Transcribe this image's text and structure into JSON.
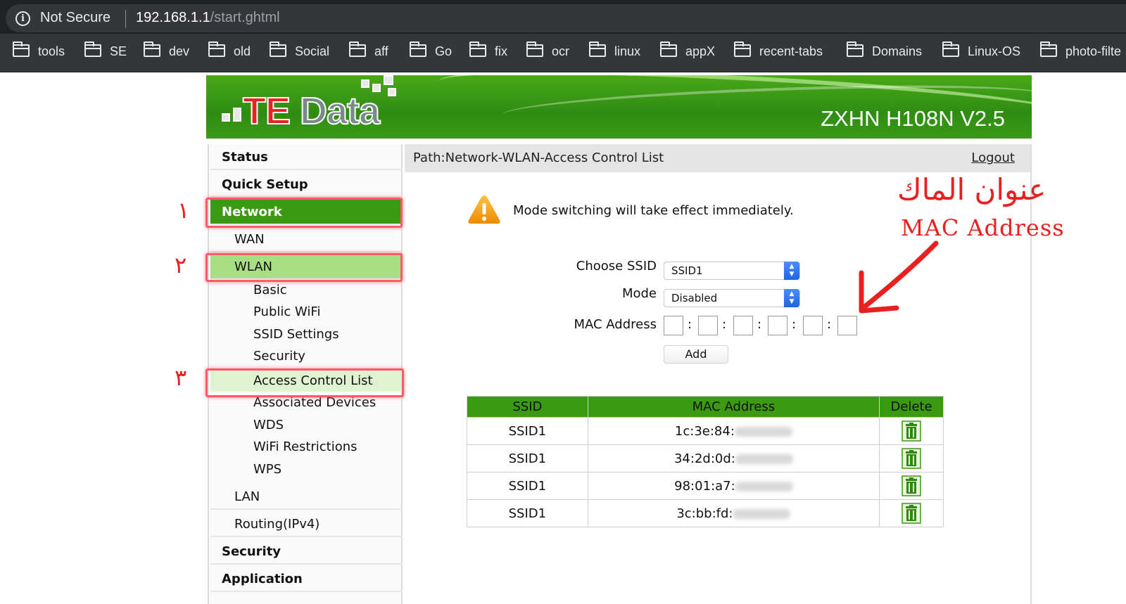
{
  "browser": {
    "security_label": "Not Secure",
    "url_host": "192.168.1.1",
    "url_path": "/start.ghtml",
    "bookmarks": [
      "tools",
      "SE",
      "dev",
      "old",
      "Social",
      "aff",
      "Go",
      "fix",
      "ocr",
      "linux",
      "appX",
      "recent-tabs",
      "Domains",
      "Linux-OS",
      "photo-filte"
    ]
  },
  "header": {
    "logo_te": "TE",
    "logo_data": "Data",
    "model": "ZXHN H108N V2.5"
  },
  "sidebar": {
    "status": "Status",
    "quick_setup": "Quick Setup",
    "network": "Network",
    "wan": "WAN",
    "wlan": "WLAN",
    "basic": "Basic",
    "public_wifi": "Public WiFi",
    "ssid_settings": "SSID Settings",
    "security_sub": "Security",
    "acl": "Access Control List",
    "associated": "Associated Devices",
    "wds": "WDS",
    "wifi_restrictions": "WiFi Restrictions",
    "wps": "WPS",
    "lan": "LAN",
    "routing": "Routing(IPv4)",
    "security": "Security",
    "application": "Application"
  },
  "annotations": {
    "step1": "١",
    "step2": "٢",
    "step3": "٣",
    "arabic_title": "عنوان الماك",
    "mac_label": "MAC Address"
  },
  "content": {
    "path": "Path:Network-WLAN-Access Control List",
    "logout": "Logout",
    "notice": "Mode switching will take effect immediately.",
    "choose_ssid_label": "Choose SSID",
    "choose_ssid_value": "SSID1",
    "mode_label": "Mode",
    "mode_value": "Disabled",
    "mac_label": "MAC Address",
    "add_button": "Add"
  },
  "table": {
    "headers": [
      "SSID",
      "MAC Address",
      "Delete"
    ],
    "rows": [
      {
        "ssid": "SSID1",
        "mac": "1c:3e:84:"
      },
      {
        "ssid": "SSID1",
        "mac": "34:2d:0d:"
      },
      {
        "ssid": "SSID1",
        "mac": "98:01:a7:"
      },
      {
        "ssid": "SSID1",
        "mac": "3c:bb:fd:"
      }
    ]
  },
  "colors": {
    "accent_green": "#3c9a12",
    "annotation_red": "#e81e1e"
  }
}
